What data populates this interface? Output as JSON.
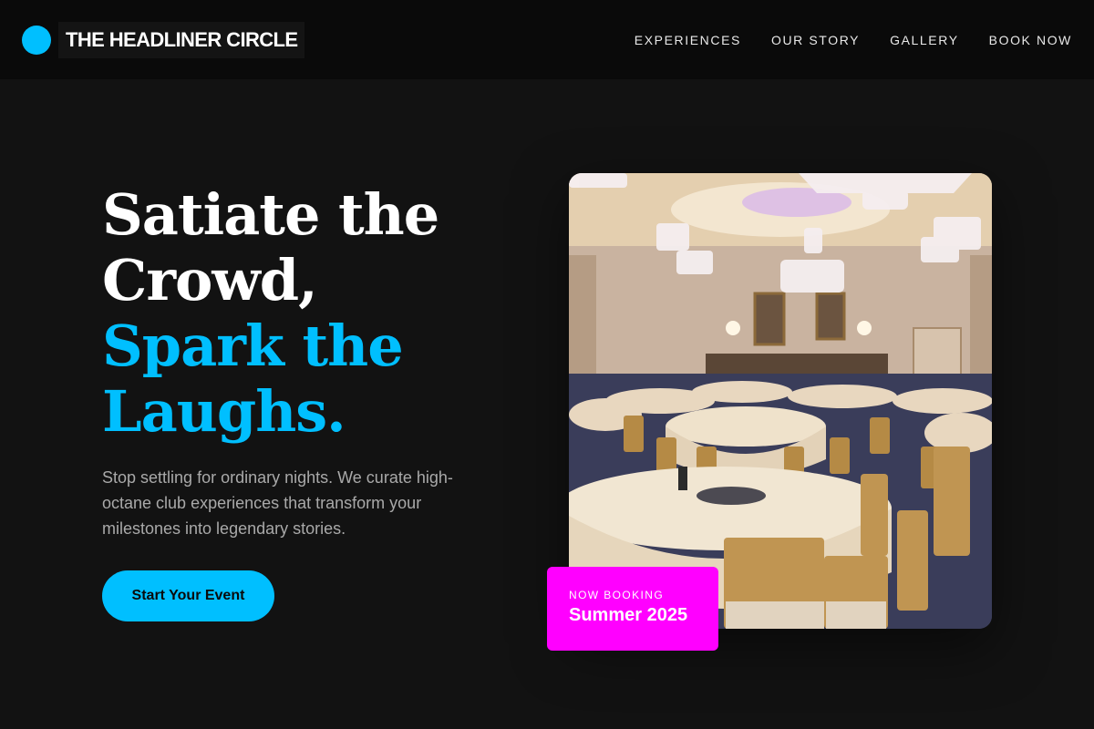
{
  "brand": {
    "name": "THE HEADLINER CIRCLE",
    "dot_color": "#00bfff"
  },
  "nav": {
    "items": [
      {
        "label": "EXPERIENCES"
      },
      {
        "label": "OUR STORY"
      },
      {
        "label": "GALLERY"
      },
      {
        "label": "BOOK NOW"
      }
    ]
  },
  "hero": {
    "headline_lines": [
      "Satiate the",
      "Crowd,"
    ],
    "headline_accent_lines": [
      "Spark the",
      "Laughs."
    ],
    "lede": "Stop settling for ordinary nights. We curate high-octane club experiences that transform your milestones into legendary stories.",
    "cta_label": "Start Your Event",
    "image_alt": "Banquet hall with round tables, gold chairs and crystal chandeliers"
  },
  "badge": {
    "kicker": "NOW BOOKING",
    "title": "Summer 2025"
  },
  "colors": {
    "background": "#121212",
    "header": "#0a0a0a",
    "accent": "#00bfff",
    "badge": "#ff00ff",
    "body_text": "#a9a9a9"
  }
}
